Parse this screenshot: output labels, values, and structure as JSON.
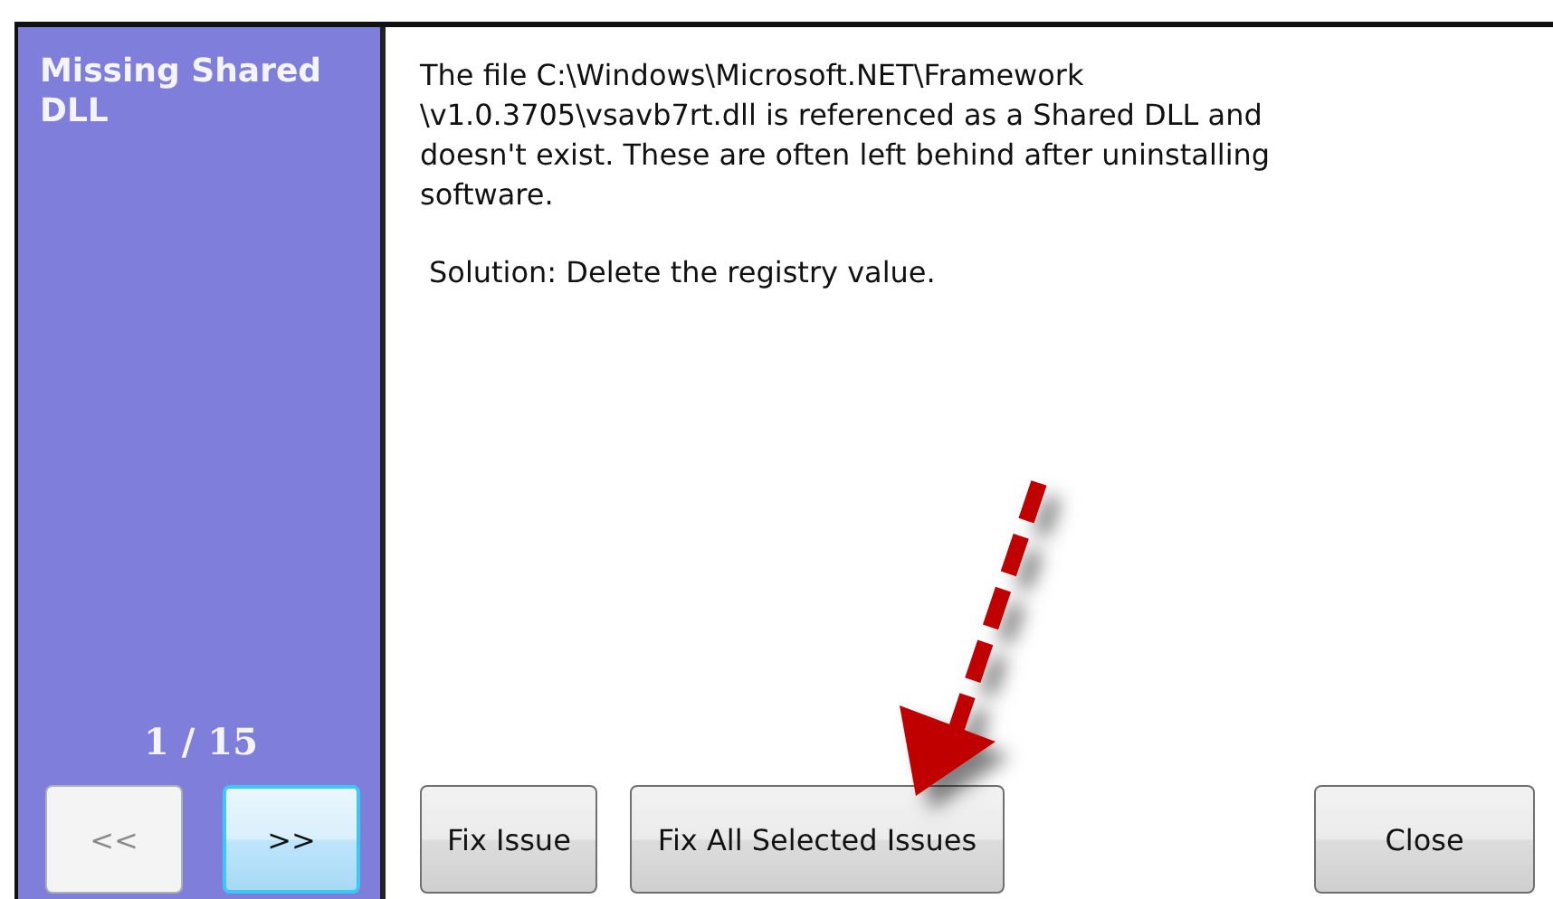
{
  "sidebar": {
    "title": "Missing Shared DLL",
    "counter": "1 / 15",
    "nav_buttons": [
      {
        "label": "<<",
        "disabled": true,
        "focused": false
      },
      {
        "label": ">>",
        "disabled": false,
        "focused": true
      }
    ]
  },
  "description": "The file C:\\Windows\\Microsoft.NET\\Framework\n\\v1.0.3705\\vsavb7rt.dll is referenced as a Shared DLL and\ndoesn't exist. These are often left behind after uninstalling\nsoftware.",
  "solution": "Solution: Delete the registry value.",
  "buttons": [
    {
      "label": "Fix Issue",
      "kind": "left"
    },
    {
      "label": "Fix All Selected Issues",
      "kind": "left"
    },
    {
      "label": "Close",
      "kind": "right"
    }
  ]
}
